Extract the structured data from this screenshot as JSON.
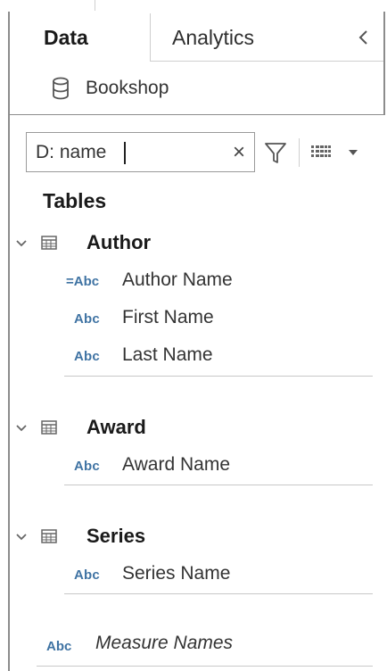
{
  "tabs": {
    "data_label": "Data",
    "analytics_label": "Analytics",
    "collapse_glyph": "<"
  },
  "datasource": {
    "name": "Bookshop",
    "icon": "database-icon"
  },
  "search": {
    "value": "D: name",
    "clear_glyph": "×",
    "icons": [
      "filter-icon",
      "view-grid-icon",
      "dropdown-arrow-icon"
    ]
  },
  "tables_heading": "Tables",
  "tables": [
    {
      "name": "Author",
      "expanded": true,
      "fields": [
        {
          "type_label": "=Abc",
          "name": "Author Name",
          "calculated": true
        },
        {
          "type_label": "Abc",
          "name": "First Name"
        },
        {
          "type_label": "Abc",
          "name": "Last Name"
        }
      ]
    },
    {
      "name": "Award",
      "expanded": true,
      "fields": [
        {
          "type_label": "Abc",
          "name": "Award Name"
        }
      ]
    },
    {
      "name": "Series",
      "expanded": true,
      "fields": [
        {
          "type_label": "Abc",
          "name": "Series Name"
        }
      ]
    }
  ],
  "measure_names": {
    "type_label": "Abc",
    "name": "Measure Names"
  },
  "colors": {
    "type_label": "#3f73a3",
    "border": "#8c8c8c"
  }
}
